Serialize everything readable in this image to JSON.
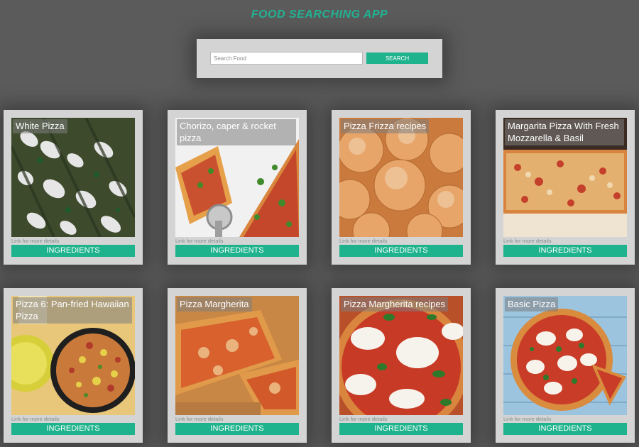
{
  "app": {
    "title": "FOOD SEARCHING APP",
    "accent_color": "#1eb38d",
    "background_color": "#5b5b5b",
    "card_color": "#d4d4d4"
  },
  "search": {
    "placeholder": "Search Food",
    "value": "",
    "button_label": "SEARCH"
  },
  "cards": [
    {
      "title": "White Pizza",
      "link": "Link for more details",
      "button": "INGREDIENTS"
    },
    {
      "title": "Chorizo, caper & rocket pizza",
      "link": "Link for more details",
      "button": "INGREDIENTS"
    },
    {
      "title": "Pizza Frizza recipes",
      "link": "Link for more details",
      "button": "INGREDIENTS"
    },
    {
      "title": "Margarita Pizza With Fresh Mozzarella & Basil",
      "link": "Link for more details",
      "button": "INGREDIENTS"
    },
    {
      "title": "Pizza 6: Pan-fried Hawaiian Pizza",
      "link": "Link for more details",
      "button": "INGREDIENTS"
    },
    {
      "title": "Pizza Margherita",
      "link": "Link for more details",
      "button": "INGREDIENTS"
    },
    {
      "title": "Pizza Margherita recipes",
      "link": "Link for more details",
      "button": "INGREDIENTS"
    },
    {
      "title": "Basic Pizza",
      "link": "Link for more details",
      "button": "INGREDIENTS"
    }
  ]
}
